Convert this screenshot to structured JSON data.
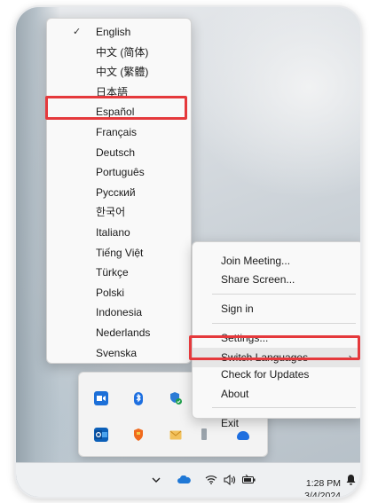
{
  "language_menu": {
    "checked_language": "English",
    "items": [
      "English",
      "中文 (简体)",
      "中文 (繁體)",
      "日本語",
      "Español",
      "Français",
      "Deutsch",
      "Português",
      "Русский",
      "한국어",
      "Italiano",
      "Tiếng Việt",
      "Türkçe",
      "Polski",
      "Indonesia",
      "Nederlands",
      "Svenska"
    ],
    "highlighted_item": "Español"
  },
  "context_menu": {
    "items": [
      "Join Meeting...",
      "Share Screen...",
      "Sign in",
      "Settings...",
      "Switch Languages",
      "Check for Updates",
      "About",
      "Exit"
    ],
    "active_item": "Switch Languages"
  },
  "tray_icons": [
    "zoom-icon",
    "bluetooth-icon",
    "defender-shield-icon",
    "generic-app-icon",
    "outlook-icon",
    "security-badge-icon",
    "mail-icon",
    "app-icon",
    "app-icon-blue"
  ],
  "taskbar": {
    "time": "1:28 PM",
    "date": "3/4/2024",
    "icons": [
      "chevron-up-icon",
      "onedrive-icon",
      "wifi-icon",
      "speaker-icon",
      "battery-icon",
      "bell-icon"
    ]
  },
  "colors": {
    "highlight_outline": "#e5393c",
    "menu_bg": "#f9f9f9"
  }
}
